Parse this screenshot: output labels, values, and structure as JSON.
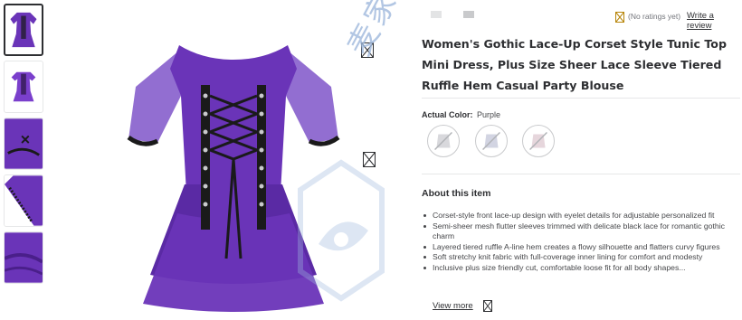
{
  "rating": {
    "no_ratings": "(No ratings yet)",
    "write_review": "Write a review"
  },
  "product": {
    "title": "Women's Gothic Lace-Up Corset Style Tunic Top Mini Dress, Plus Size Sheer Lace Sleeve Tiered Ruffle Hem Casual Party Blouse",
    "color_label": "Actual Color:",
    "color_value": "Purple",
    "swatches": [
      {
        "name": "swatch-1",
        "state": "unavailable"
      },
      {
        "name": "swatch-2",
        "state": "unavailable"
      },
      {
        "name": "swatch-3",
        "state": "unavailable"
      }
    ]
  },
  "about": {
    "heading": "About this item",
    "bullets": [
      "Corset-style front lace-up design with eyelet details for adjustable personalized fit",
      "Semi-sheer mesh flutter sleeves trimmed with delicate black lace for romantic gothic charm",
      "Layered tiered ruffle A-line hem creates a flowy silhouette and flatters curvy figures",
      "Soft stretchy knit fabric with full-coverage inner lining for comfort and modesty",
      "Inclusive plus size friendly cut, comfortable loose fit for all body shapes..."
    ],
    "view_more": "View more"
  },
  "watermark": {
    "text": "麦家星球"
  },
  "colors": {
    "dress_purple": "#6a34b8",
    "dress_dark": "#4a1f8a",
    "lace_black": "#1a1a1a",
    "link": "#2e2f32",
    "muted": "#74767c",
    "watermark_blue": "#9fb9dd"
  },
  "icons": {
    "image_placeholder": "broken-image-icon",
    "rating": "rating-placeholder-icon",
    "view_more": "expand-icon"
  }
}
